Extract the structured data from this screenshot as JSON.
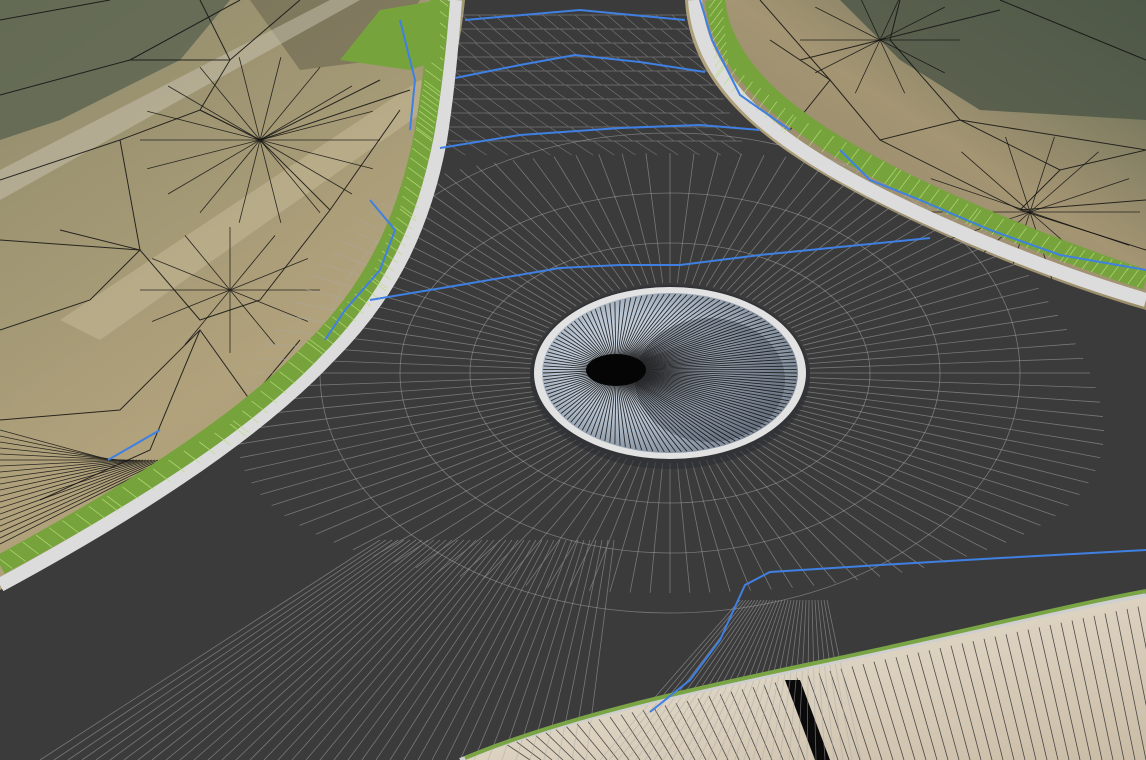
{
  "viewport": {
    "view": "3d-perspective",
    "display_mode": "textured-wireframe",
    "has_visible_text": false
  },
  "scene": {
    "feature": "roundabout",
    "legs": 3,
    "central_island": "circular",
    "wireframe": true
  },
  "colors": {
    "pavement": "#3a3a3a",
    "wireframe": "#a6a6a6",
    "curb": "#d8d8d8",
    "verge": "#6f9a3a",
    "verge_highlight": "#9acb55",
    "breakline": "#3f7fe0",
    "terrain_tan": "#a69872",
    "terrain_dark": "#4a5a48",
    "island_fill": "#b8c6d6",
    "island_shadow": "#2e3540",
    "terrain_edge": "#111111",
    "sidewalk": "#e6ddcd"
  }
}
